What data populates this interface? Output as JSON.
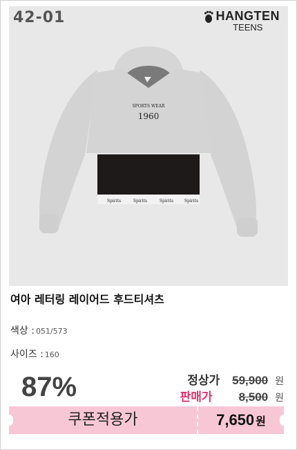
{
  "product": {
    "code": "42-01",
    "brand_name": "HANGTEN",
    "brand_sub": "TEENS",
    "title": "여아 레터링 레이어드 후드티셔츠",
    "color_label": "색상 :",
    "color_value": "051/573",
    "size_label": "사이즈 :",
    "size_value": "160",
    "print_text": "1960",
    "band_text": "Spirits"
  },
  "pricing": {
    "discount": "87%",
    "regular_label": "정상가",
    "regular_price": "59,900",
    "sale_label": "판매가",
    "sale_price": "8,500",
    "currency": "원",
    "coupon_label": "쿠폰적용가",
    "coupon_price": "7,650",
    "coupon_currency": "원"
  },
  "colors": {
    "regular_label": "#333333",
    "sale_label": "#e0326e",
    "coupon_bg": "#f7c7d6"
  }
}
